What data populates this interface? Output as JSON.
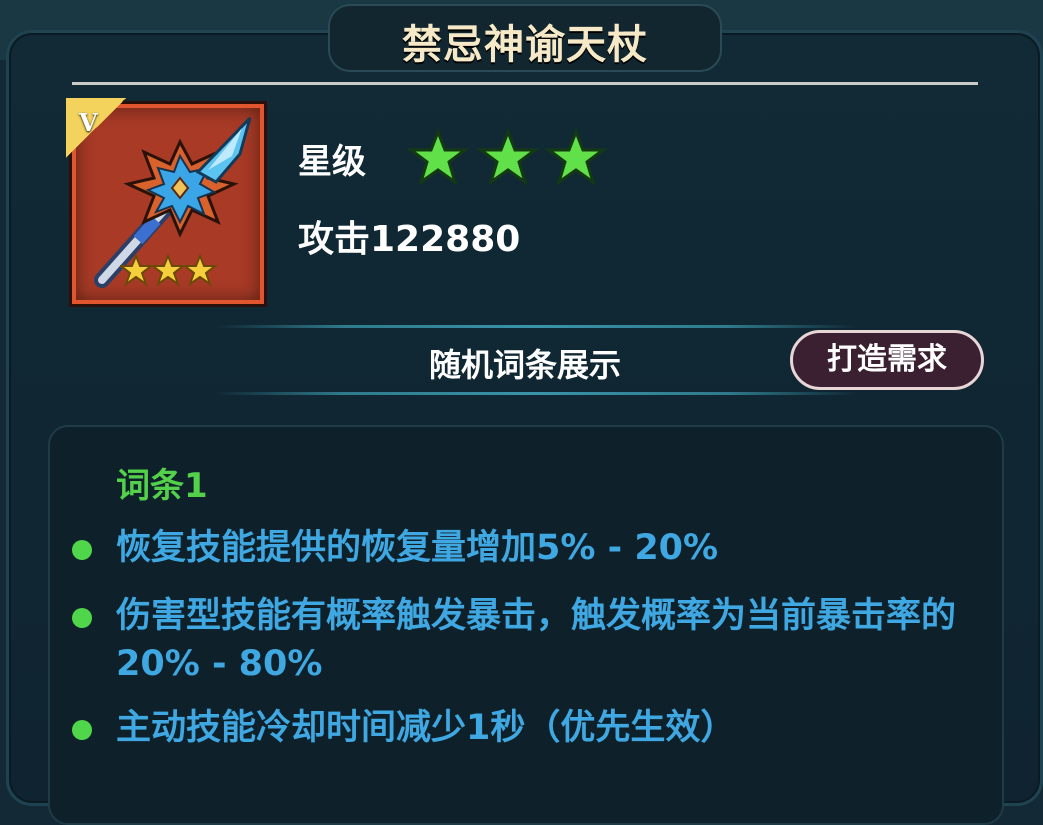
{
  "dialog": {
    "title": "禁忌神谕天杖",
    "item_icon": {
      "name": "staff-icon",
      "badge": "V",
      "stars": 3
    },
    "star_label": "星级",
    "star_rating": 3,
    "attack_text": "攻击122880"
  },
  "section": {
    "title": "随机词条展示",
    "forge_button": "打造需求"
  },
  "affixes": {
    "title": "词条1",
    "items": [
      "恢复技能提供的恢复量增加5% - 20%",
      "伤害型技能有概率触发暴击，触发概率为当前暴击率的20% - 80%",
      "主动技能冷却时间减少1秒（优先生效）"
    ]
  },
  "colors": {
    "star": "#4fd64a",
    "affix_title": "#53d14a",
    "affix_text": "#3fa8e2",
    "icon_bg": "#a83a26"
  }
}
